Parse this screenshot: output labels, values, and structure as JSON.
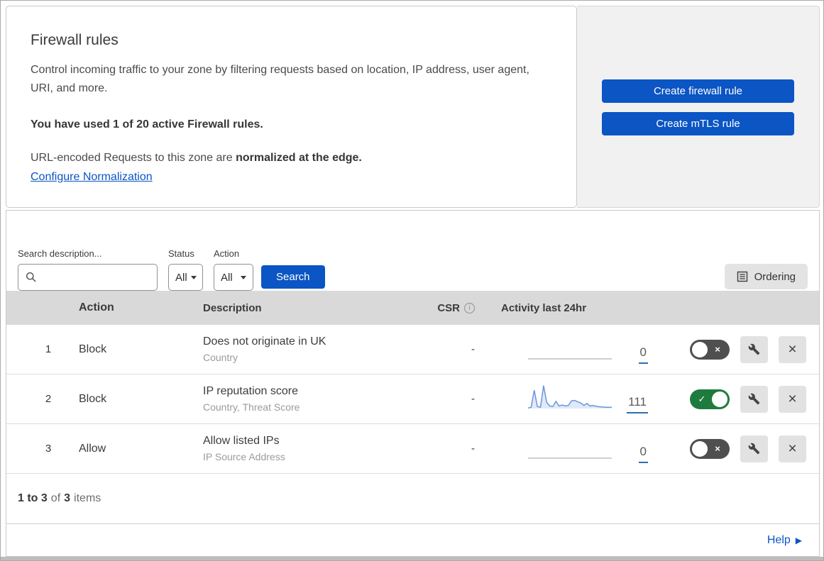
{
  "intro": {
    "title": "Firewall rules",
    "description": "Control incoming traffic to your zone by filtering requests based on location, IP address, user agent, URI, and more.",
    "usage_text": "You have used 1 of 20 active Firewall rules.",
    "normalization_prefix": "URL-encoded Requests to this zone are ",
    "normalization_bold": "normalized at the edge.",
    "normalization_link_label": "Configure Normalization"
  },
  "actions_panel": {
    "create_firewall_rule_label": "Create firewall rule",
    "create_mtls_rule_label": "Create mTLS rule"
  },
  "filters": {
    "search_label": "Search description...",
    "search_value": "",
    "status_label": "Status",
    "status_value": "All",
    "action_label": "Action",
    "action_value": "All",
    "search_button_label": "Search",
    "ordering_button_label": "Ordering"
  },
  "table": {
    "headers": {
      "action": "Action",
      "description": "Description",
      "csr": "CSR",
      "activity": "Activity last 24hr"
    },
    "rows": [
      {
        "index": "1",
        "action": "Block",
        "description": "Does not originate in UK",
        "fields": "Country",
        "csr": "-",
        "activity_count": "0",
        "enabled": false
      },
      {
        "index": "2",
        "action": "Block",
        "description": "IP reputation score",
        "fields": "Country, Threat Score",
        "csr": "-",
        "activity_count": "111",
        "enabled": true
      },
      {
        "index": "3",
        "action": "Allow",
        "description": "Allow listed IPs",
        "fields": "IP Source Address",
        "csr": "-",
        "activity_count": "0",
        "enabled": false
      }
    ]
  },
  "sparkline": {
    "type": "line",
    "row": 2,
    "color": "#6d96dc",
    "fill": "#e0e9f8",
    "values": [
      2,
      5,
      72,
      8,
      5,
      90,
      25,
      10,
      8,
      28,
      10,
      14,
      10,
      12,
      30,
      32,
      26,
      22,
      12,
      20,
      10,
      12,
      9,
      7,
      6,
      5,
      5,
      5
    ]
  },
  "footer": {
    "range": "1 to 3",
    "of_label": "of",
    "total": "3",
    "items_label": "items",
    "help_label": "Help"
  },
  "icons": {
    "toggle_on_check": "✓",
    "toggle_off_cross": "×",
    "delete_cross": "×",
    "help_arrow": "▶",
    "csr_info": "i"
  },
  "colors": {
    "accent_blue": "#0b55c4",
    "toggle_on_green": "#1e7b3d",
    "toggle_off_gray": "#4f4f4f",
    "table_header_gray": "#d9d9d9",
    "panel_gray": "#f1f1f1",
    "count_underline_blue": "#2b70ae",
    "sparkline_blue": "#6d96dc"
  }
}
